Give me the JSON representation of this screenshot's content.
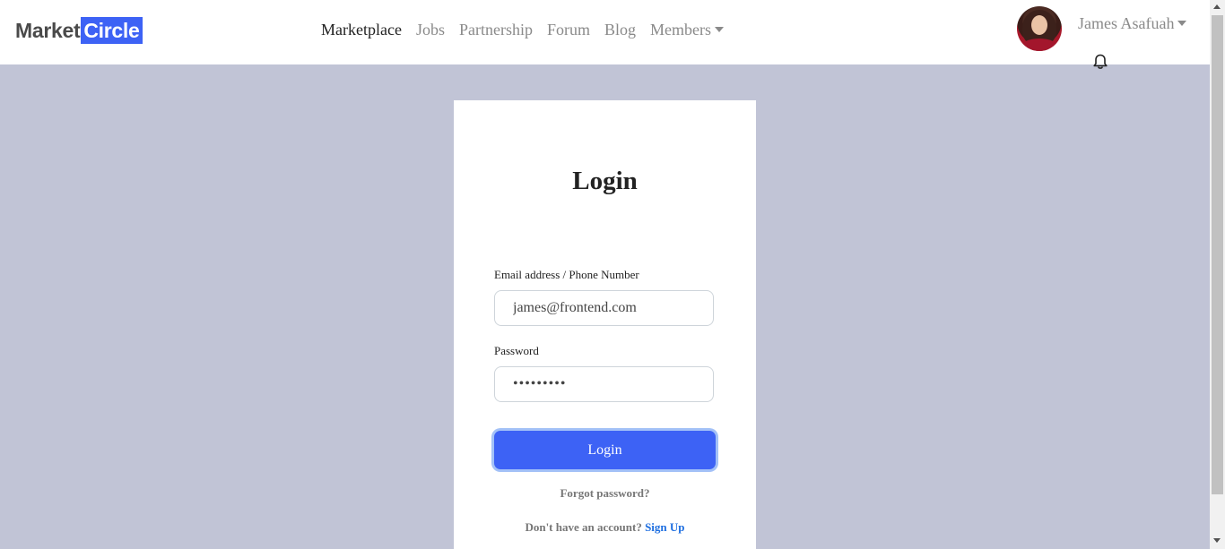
{
  "navbar": {
    "logo_part1": "Market",
    "logo_part2": "Circle",
    "links": [
      "Marketplace",
      "Jobs",
      "Partnership",
      "Forum",
      "Blog",
      "Members"
    ],
    "user_name": "James Asafuah",
    "icons": {
      "notifications": "bell-icon",
      "dropdown": "caret-down-icon"
    }
  },
  "login": {
    "title": "Login",
    "email_label": "Email address / Phone Number",
    "email_value": "james@frontend.com",
    "password_label": "Password",
    "password_value": "•••••••••",
    "submit_label": "Login",
    "forgot_password": "Forgot password?",
    "no_account_text": "Don't have an account?",
    "signup_label": "Sign Up"
  },
  "colors": {
    "brand": "#3d62f5",
    "page_background": "#c1c4d6",
    "link": "#1f6fe0"
  }
}
